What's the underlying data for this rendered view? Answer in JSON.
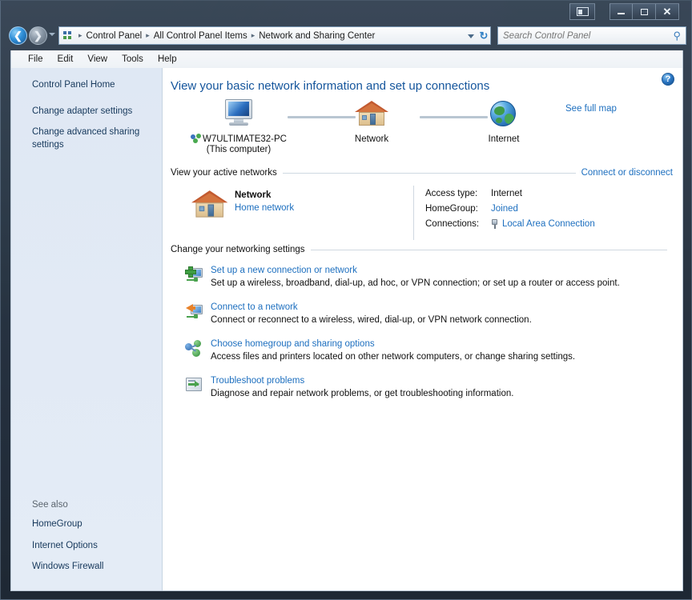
{
  "window": {
    "titlebar": {
      "preview_button_name": "preview-pane-button",
      "minimize_label": "–",
      "maximize_label": "□",
      "close_label": "✕"
    },
    "nav": {
      "back_label": "←",
      "forward_label": "→",
      "refresh_label": "↻",
      "breadcrumbs": [
        "Control Panel",
        "All Control Panel Items",
        "Network and Sharing Center"
      ],
      "separator": "▸"
    },
    "search": {
      "placeholder": "Search Control Panel",
      "value": "",
      "icon": "search-icon"
    },
    "menubar": [
      "File",
      "Edit",
      "View",
      "Tools",
      "Help"
    ]
  },
  "sidebar": {
    "home_label": "Control Panel Home",
    "links": [
      "Change adapter settings",
      "Change advanced sharing settings"
    ],
    "see_also": {
      "title": "See also",
      "items": [
        "HomeGroup",
        "Internet Options",
        "Windows Firewall"
      ]
    }
  },
  "main": {
    "help_label": "?",
    "heading": "View your basic network information and set up connections",
    "map": {
      "see_full_map": "See full map",
      "nodes": [
        {
          "label": "W7ULTIMATE32-PC",
          "sub": "(This computer)",
          "icon": "computer-icon"
        },
        {
          "label": "Network",
          "sub": "",
          "icon": "house-icon"
        },
        {
          "label": "Internet",
          "sub": "",
          "icon": "globe-icon"
        }
      ]
    },
    "active_networks": {
      "section_label": "View your active networks",
      "section_action": "Connect or disconnect",
      "network_name": "Network",
      "network_type": "Home network",
      "properties": [
        {
          "key": "Access type:",
          "value": "Internet",
          "link": false,
          "icon": ""
        },
        {
          "key": "HomeGroup:",
          "value": "Joined",
          "link": true,
          "icon": ""
        },
        {
          "key": "Connections:",
          "value": "Local Area Connection",
          "link": true,
          "icon": "lan-icon"
        }
      ]
    },
    "settings": {
      "section_label": "Change your networking settings",
      "tasks": [
        {
          "icon": "add-connection-icon",
          "title": "Set up a new connection or network",
          "desc": "Set up a wireless, broadband, dial-up, ad hoc, or VPN connection; or set up a router or access point."
        },
        {
          "icon": "connect-network-icon",
          "title": "Connect to a network",
          "desc": "Connect or reconnect to a wireless, wired, dial-up, or VPN network connection."
        },
        {
          "icon": "homegroup-icon",
          "title": "Choose homegroup and sharing options",
          "desc": "Access files and printers located on other network computers, or change sharing settings."
        },
        {
          "icon": "troubleshoot-icon",
          "title": "Troubleshoot problems",
          "desc": "Diagnose and repair network problems, or get troubleshooting information."
        }
      ]
    }
  },
  "colors": {
    "link": "#1d6fbf",
    "heading": "#14559c",
    "sidebar_bg": "#e1e9f5",
    "content_bg": "#ffffff"
  }
}
